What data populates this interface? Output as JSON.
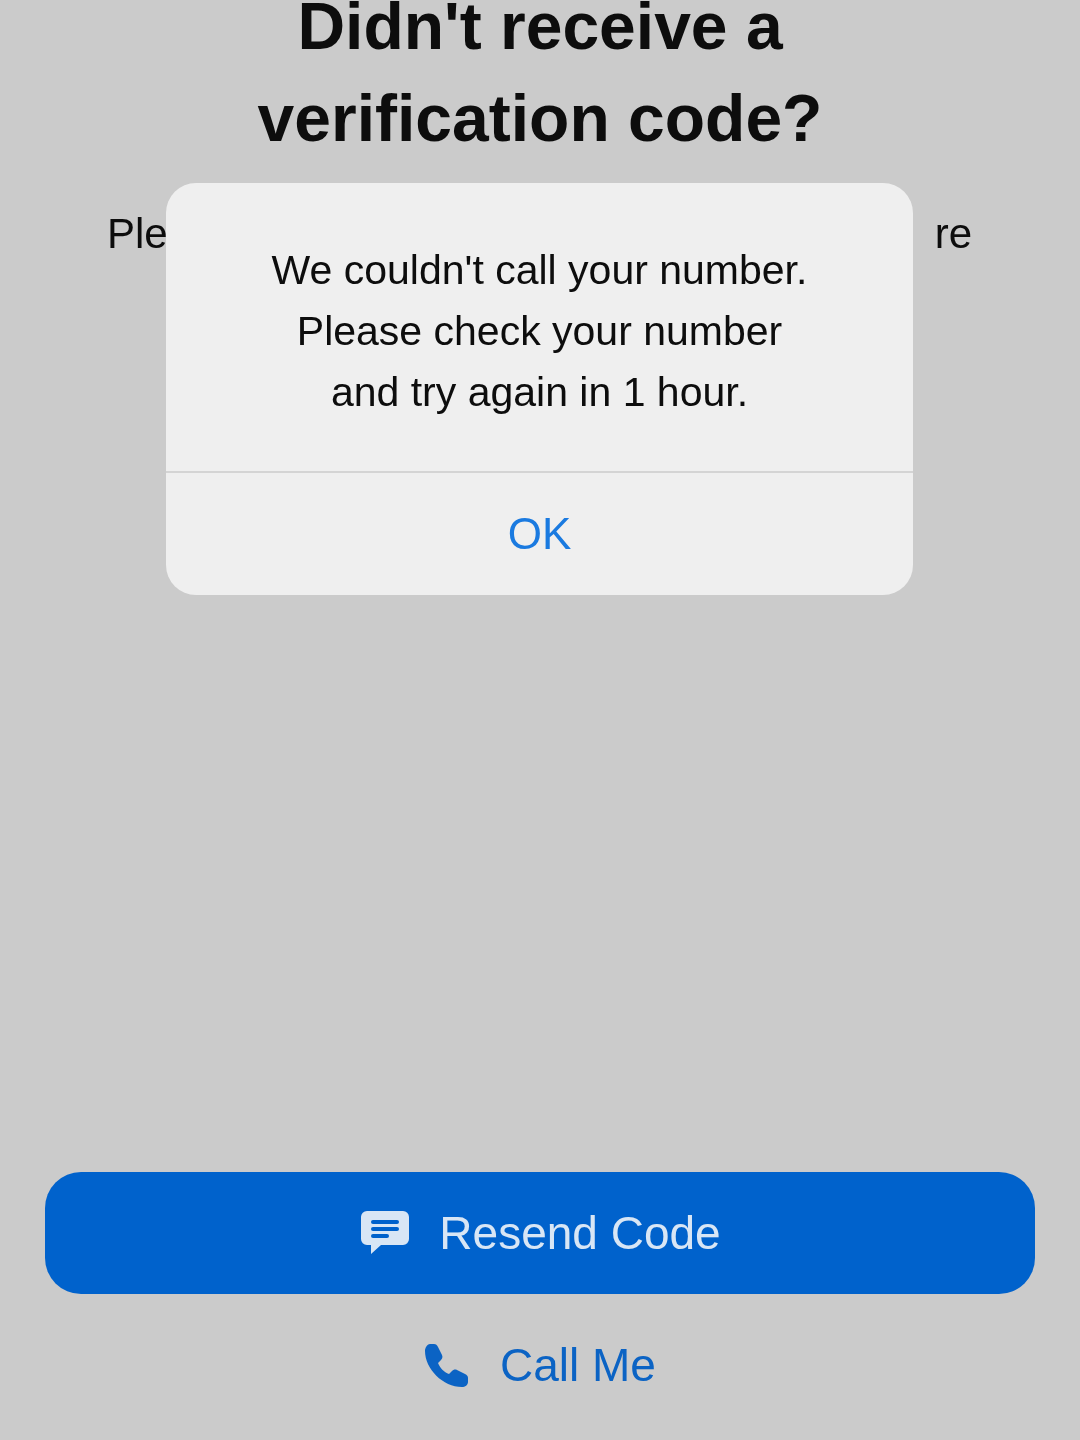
{
  "title": [
    "Didn't receive a",
    "verification code?"
  ],
  "body_fragments": [
    "Ple",
    "re"
  ],
  "alert": {
    "message": [
      "We couldn't call your number.",
      "Please check your number",
      "and try again in 1 hour."
    ],
    "button": "OK"
  },
  "primary_button": {
    "label": "Resend Code"
  },
  "secondary_button": {
    "label": "Call Me"
  }
}
